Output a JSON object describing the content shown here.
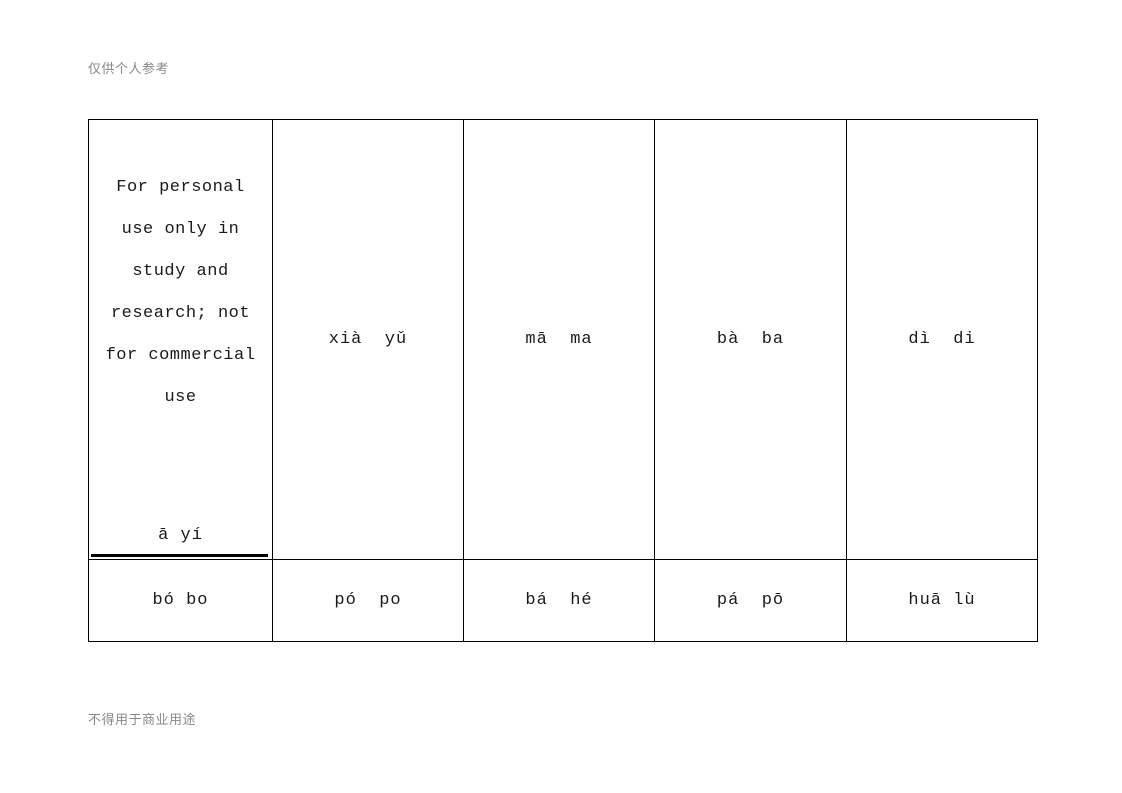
{
  "watermarks": {
    "top": "仅供个人参考",
    "bottom": "不得用于商业用途",
    "notice": "For personal\nuse only in\nstudy and\nresearch; not\nfor commercial\nuse"
  },
  "table": {
    "rows": [
      {
        "cells": [
          {
            "pinyin": "ā  yí"
          },
          {
            "pinyin": "xià  yǔ"
          },
          {
            "pinyin": "mā  ma"
          },
          {
            "pinyin": "bà  ba"
          },
          {
            "pinyin": "dì  di"
          }
        ]
      },
      {
        "cells": [
          {
            "pinyin": "bó bo"
          },
          {
            "pinyin": "pó  po"
          },
          {
            "pinyin": "bá  hé"
          },
          {
            "pinyin": "pá  pō"
          },
          {
            "pinyin": "huā lù"
          }
        ]
      }
    ]
  },
  "colors": {
    "border": "#000000",
    "text": "#1a1a1a",
    "watermark": "#888888",
    "background": "#ffffff"
  }
}
